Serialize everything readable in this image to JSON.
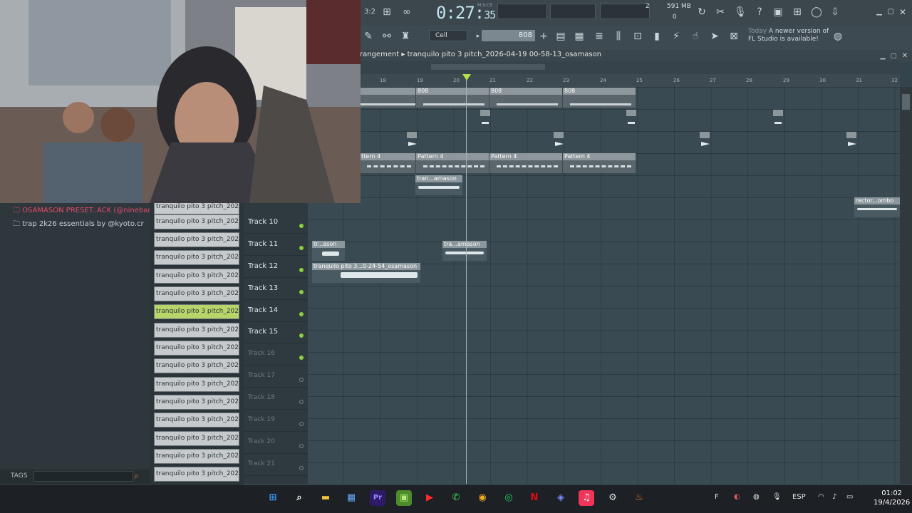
{
  "app": {
    "name": "FL Studio"
  },
  "transport": {
    "time": "0:27",
    "time_frac": "35",
    "time_label": "M:S:CS"
  },
  "system_meter": {
    "cpu": "2",
    "memory": "591 MB",
    "polyphony": "0"
  },
  "toolbar": {
    "snap": "Cell",
    "pattern": "808"
  },
  "hint": {
    "prefix": "Today",
    "message": "A newer version of",
    "message2": "FL Studio is available!"
  },
  "playlist": {
    "title": "rangement ▸ tranquilo pito 3 pitch_2026-04-19 00-58-13_osamason",
    "ruler": [
      "18",
      "19",
      "20",
      "21",
      "22",
      "23",
      "24",
      "25",
      "26",
      "27",
      "28",
      "29",
      "30",
      "31",
      "32"
    ],
    "clips": [
      {
        "label": "808"
      },
      {
        "label": "808"
      },
      {
        "label": "808"
      },
      {
        "label": "ttern 4"
      },
      {
        "label": "Pattern 4"
      },
      {
        "label": "Pattern 4"
      },
      {
        "label": "Pattern 4"
      },
      {
        "label": "tran...amason"
      },
      {
        "label": "tr...ason"
      },
      {
        "label": "tra...amason"
      },
      {
        "label": "tranquilo pito 3...0-24-54_osamason"
      },
      {
        "label": "rector...ombo"
      }
    ],
    "tracks": [
      {
        "name": "Track 10"
      },
      {
        "name": "Track 11"
      },
      {
        "name": "Track 12"
      },
      {
        "name": "Track 13"
      },
      {
        "name": "Track 14"
      },
      {
        "name": "Track 15"
      },
      {
        "name": "Track 16"
      },
      {
        "name": "Track 17"
      },
      {
        "name": "Track 18"
      },
      {
        "name": "Track 19"
      },
      {
        "name": "Track 20"
      },
      {
        "name": "Track 21"
      }
    ]
  },
  "browser": {
    "items": [
      {
        "label": "OSAMASON PRESET..ACK (@ninebangs)",
        "color": "#e84a6a"
      },
      {
        "label": "trap 2k26 essentials by @kyoto.cr",
        "color": "#c8d0d4"
      }
    ],
    "tags_label": "TAGS"
  },
  "picker": [
    "tranquilo pito 3 pitch_202",
    "tranquilo pito 3 pitch_202",
    "tranquilo pito 3 pitch_202",
    "tranquilo pito 3 pitch_202",
    "tranquilo pito 3 pitch_202",
    "tranquilo pito 3 pitch_202",
    "tranquilo pito 3 pitch_202",
    "tranquilo pito 3 pitch_202",
    "tranquilo pito 3 pitch_202",
    "tranquilo pito 3 pitch_202",
    "tranquilo pito 3 pitch_202",
    "tranquilo pito 3 pitch_202",
    "tranquilo pito 3 pitch_202",
    "tranquilo pito 3 pitch_202",
    "tranquilo pito 3 pitch_202",
    "tranquilo pito 3 pitch_202",
    "tranquilo pito 3 pitch_202"
  ],
  "taskbar": {
    "lang": "ESP",
    "time": "01:02",
    "date": "19/4/2026"
  }
}
